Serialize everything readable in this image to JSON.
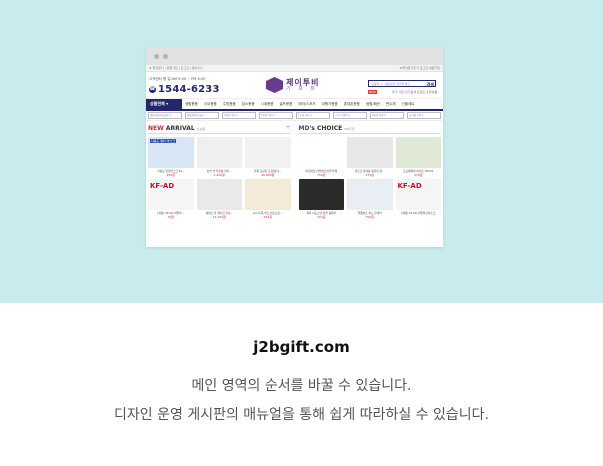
{
  "hero": {
    "background": "#c8ecec"
  },
  "topbar": {
    "left": "★ 즐겨찾기 | 회원가입 | 로그인 | 장바구니",
    "right": "★즐겨찾기추가  로그인  회원가입"
  },
  "header": {
    "cs_label": "고객센터  평 일 AM 9:00 ~ PM 6:00",
    "phone": "1544-6233",
    "logo_ko": "제이투비",
    "logo_sub": "기 프 트",
    "search_placeholder": "상품명 or 상품번호 입력하세요",
    "search_button": "검색",
    "badge": "NEW",
    "links": "후기  사은  인기검색  트렌드  추천상품"
  },
  "nav": {
    "all": "상품전체 ▾",
    "items": [
      "생활용품",
      "사무용품",
      "주방용품",
      "업소용품",
      "시계용품",
      "골프용품",
      "레저/스포츠",
      "여행가용품",
      "휴대폰용품",
      "생활/패션",
      "판수제",
      "선물세트"
    ]
  },
  "filters": [
    "생활용품/선물세트 ▾",
    "생활용품/선물 ▾",
    "2천원 이하 ▾",
    "5천원 이하 ▾",
    "1만원 이하 ▾",
    "스포츠/레저 ▾",
    "6천원 이상 ▾",
    "단가별 검색 ▾"
  ],
  "sections": [
    {
      "title_accent": "NEW",
      "title_rest": " ARRIVAL",
      "sub": "신상품",
      "plus": "+",
      "products": [
        {
          "tag": "다용도 멀티 마스크",
          "kf": "",
          "caption": "다용도 방한마스크 DJ...",
          "price": "250원",
          "color": "#d9e6f6"
        },
        {
          "tag": "",
          "kf": "",
          "caption": "순면 면 현장용 물티...",
          "price": "1,400원",
          "color": "#efefef"
        },
        {
          "tag": "",
          "kf": "",
          "caption": "일회 포장지 포장재/기...",
          "price": "26,800원",
          "color": "#f1f1f1"
        },
        {
          "tag": "",
          "kf": "KF-AD",
          "caption": "[개성] KF-AD 비말차...",
          "price": "70원",
          "color": "#f5f5f5"
        },
        {
          "tag": "",
          "kf": "",
          "caption": "퀘이트 일 레이크 물사...",
          "price": "12,700원",
          "color": "#e9e9e9"
        },
        {
          "tag": "",
          "kf": "",
          "caption": "ecol가죽 하스 판소포장...",
          "price": "470원",
          "color": "#f3ebd8"
        }
      ]
    },
    {
      "title_accent": "MD",
      "title_rest": "'s CHOICE",
      "sub": "MD추천",
      "plus": "",
      "products": [
        {
          "tag": "",
          "kf": "",
          "caption": "미래지장 반첩엔/스타투부채",
          "price": "750원",
          "color": "#ffffff"
        },
        {
          "tag": "",
          "kf": "",
          "caption": "마스크 휴대용 목걸이 걸...",
          "price": "470원",
          "color": "#e8e8e8"
        },
        {
          "tag": "",
          "kf": "",
          "caption": "프로페셔널 바이스 300ml",
          "price": "470원",
          "color": "#dfe9d6"
        },
        {
          "tag": "",
          "kf": "",
          "caption": "챌리 지도스텐 반찬 통틀어",
          "price": "300원",
          "color": "#2b2b2b"
        },
        {
          "tag": "",
          "kf": "",
          "caption": "일품아트 치노 블레이",
          "price": "750원",
          "color": "#e9eef5"
        },
        {
          "tag": "",
          "kf": "KF-AD",
          "caption": "[개성] KF-AD 비말차단마스크",
          "price": "",
          "color": "#f5f5f5"
        }
      ]
    }
  ],
  "site": "j2bgift.com",
  "line1": "메인 영역의 순서를 바꿀 수 있습니다.",
  "line2": "디자인 운영 게시판의 매뉴얼을 통해 쉽게 따라하실 수 있습니다."
}
